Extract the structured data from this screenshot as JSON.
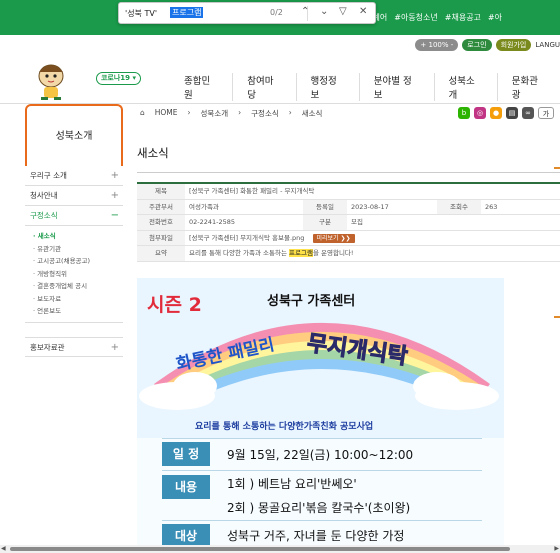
{
  "find": {
    "history": "'성북 TV'",
    "query": "프로그램",
    "count": "0/2"
  },
  "top_tags": [
    "예어",
    "#아동청소년",
    "#채용공고",
    "#아"
  ],
  "controls": {
    "zoom": "+ 100% -",
    "login": "로그인",
    "join": "회원가입",
    "lang": "LANGU"
  },
  "corona_label": "코로나19 ▾",
  "menu": [
    "종합민원",
    "참여마당",
    "행정정보",
    "분야별 정보",
    "성북소개",
    "문화관광"
  ],
  "sidebar": {
    "title": "성북소개",
    "items": [
      {
        "label": "우리구 소개",
        "pm": "+"
      },
      {
        "label": "청사안내",
        "pm": "+"
      },
      {
        "label": "구정소식",
        "pm": "−"
      }
    ],
    "subs": [
      "새소식",
      "유관기관",
      "고시공고(채용공고)",
      "개방형직위",
      "결혼중개업체 공시",
      "보도자료",
      "언론보도"
    ],
    "extra": {
      "label": "홍보자료관",
      "pm": "+"
    }
  },
  "breadcrumb": [
    "HOME",
    "성북소개",
    "구정소식",
    "새소식"
  ],
  "page_title": "새소식",
  "info": {
    "title_label": "제목",
    "title_value": "[성북구 가족센터] 화통한 패밀리 - 무지개식탁",
    "dept_label": "주관부서",
    "dept_value": "여성가족과",
    "date_label": "등록일",
    "date_value": "2023-08-17",
    "views_label": "조회수",
    "views_value": "263",
    "phone_label": "전화번호",
    "phone_value": "02-2241-2585",
    "type_label": "구분",
    "type_value": "모집",
    "file_label": "첨부파일",
    "file_value": "[성북구 가족센터] 무지개식탁 홍보물.png",
    "file_btn": "미리보기",
    "summary_label": "요약",
    "summary_pre": "요리를 통해 다양한 가족과 소통하는 ",
    "summary_hl": "프로그램",
    "summary_post": "을 운영합니다!"
  },
  "poster": {
    "season": "시즌 2",
    "org": "성북구 가족센터",
    "happy": "화통한 패밀리",
    "rainbow": "무지개식탁",
    "slogan": "요리를 통해 소통하는 다양한가족친화 공모사업",
    "schedule_label": "일 정",
    "schedule_value": "9월 15일, 22일(금) 10:00~12:00",
    "content_label": "내용",
    "content_1": "1회 ) 베트남 요리'반쎄오'",
    "content_2": "2회 ) 몽골요리'볶음 칼국수'(초이왕)",
    "target_label": "대상",
    "target_value": "성북구 거주, 자녀를 둔 다양한 가정"
  }
}
